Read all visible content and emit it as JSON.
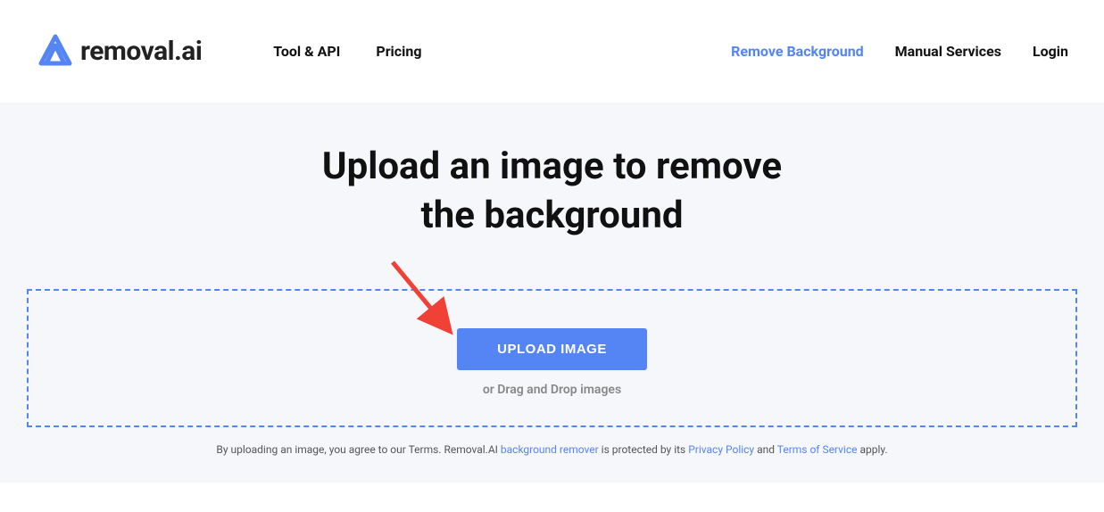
{
  "header": {
    "logo_text": "removal.ai",
    "nav_left": [
      {
        "label": "Tool & API"
      },
      {
        "label": "Pricing"
      }
    ],
    "nav_right": [
      {
        "label": "Remove Background",
        "active": true
      },
      {
        "label": "Manual Services"
      },
      {
        "label": "Login"
      }
    ]
  },
  "hero": {
    "title_line1": "Upload an image to remove",
    "title_line2": "the background",
    "upload_button": "UPLOAD IMAGE",
    "drag_text": "or Drag and Drop images"
  },
  "legal": {
    "prefix": "By uploading an image, you agree to our Terms. Removal.AI ",
    "link1": "background remover",
    "middle1": " is protected by its ",
    "link2": "Privacy Policy",
    "middle2": " and ",
    "link3": "Terms of Service",
    "suffix": " apply."
  },
  "colors": {
    "accent": "#5584f5",
    "muted_bg": "#f5f7fa"
  }
}
